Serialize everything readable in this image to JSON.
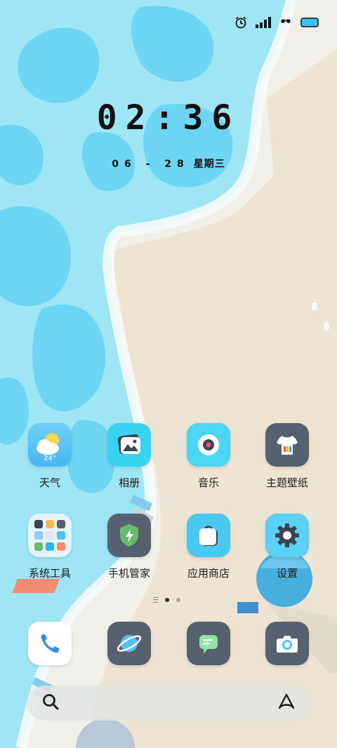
{
  "status_bar": {
    "icons": [
      "alarm-icon",
      "signal-icon",
      "leaf-icon",
      "battery-icon"
    ],
    "battery_color": "#3cc4ea"
  },
  "clock": {
    "time": "02:36"
  },
  "date": {
    "date": "06 - 28",
    "weekday": "星期三"
  },
  "apps_row1": [
    {
      "name": "weather",
      "label": "天气",
      "icon": "weather-icon",
      "temp": "24°",
      "color": "#4fc3f7"
    },
    {
      "name": "gallery",
      "label": "相册",
      "icon": "gallery-icon",
      "color": "#37d3f0"
    },
    {
      "name": "music",
      "label": "音乐",
      "icon": "music-icon",
      "color": "#4dd6f3"
    },
    {
      "name": "themes",
      "label": "主题壁纸",
      "icon": "theme-icon",
      "color": "#56606e"
    }
  ],
  "apps_row2": [
    {
      "name": "system-tools",
      "label": "系统工具",
      "icon": "folder-icon"
    },
    {
      "name": "security",
      "label": "手机管家",
      "icon": "shield-icon",
      "color": "#56606e"
    },
    {
      "name": "app-store",
      "label": "应用商店",
      "icon": "store-icon",
      "color": "#49c9f2"
    },
    {
      "name": "settings",
      "label": "设置",
      "icon": "gear-icon",
      "color": "#59d0f4"
    }
  ],
  "dock": [
    {
      "name": "phone",
      "icon": "phone-icon"
    },
    {
      "name": "browser",
      "icon": "browser-icon"
    },
    {
      "name": "messages",
      "icon": "message-icon"
    },
    {
      "name": "camera",
      "icon": "camera-icon"
    }
  ],
  "page_indicator": {
    "pages": 2,
    "current": 1
  },
  "search_bar": {
    "left_icon": "search-icon",
    "right_icon": "assistant-icon"
  }
}
